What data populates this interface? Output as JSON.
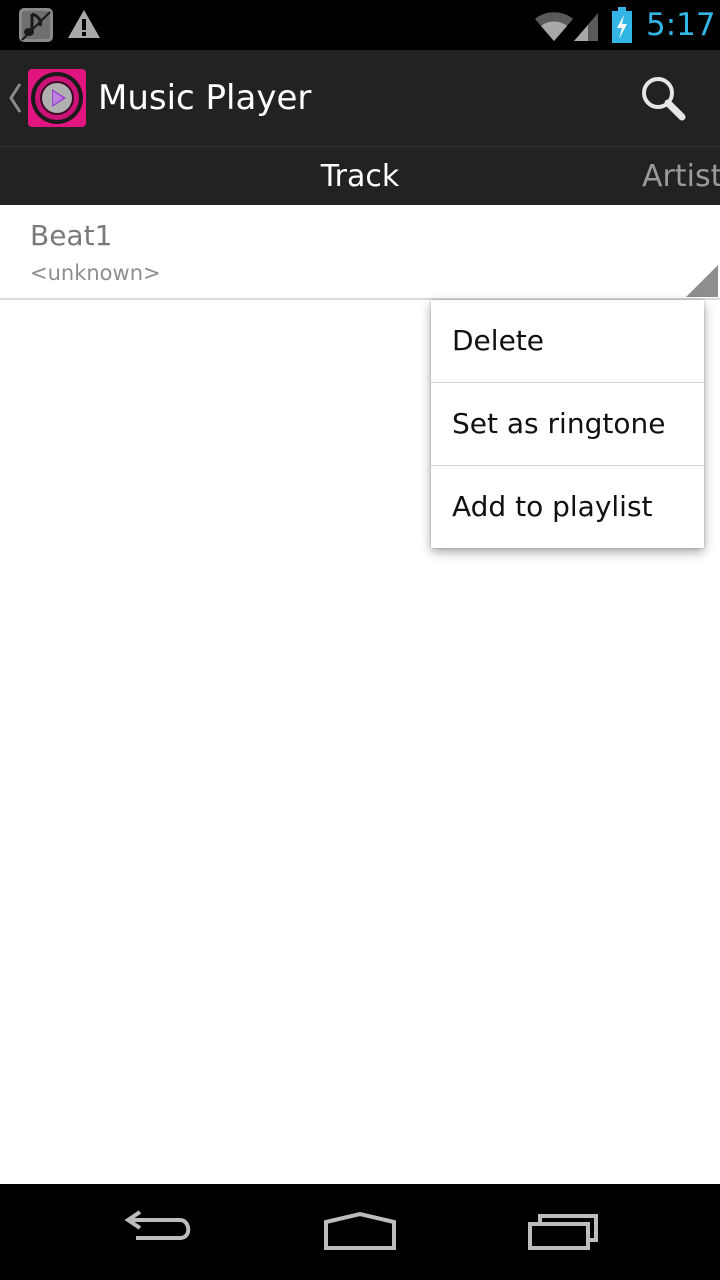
{
  "status_bar": {
    "time": "5:17",
    "notifications": [
      "music-note-icon",
      "warning-icon"
    ],
    "indicators": [
      "wifi-icon",
      "signal-icon",
      "battery-charging-icon"
    ],
    "clock_color": "#33b5e5"
  },
  "action_bar": {
    "title": "Music Player",
    "app_icon": "music-player-app-icon",
    "search_icon": "search-icon",
    "background": "#222222"
  },
  "tabs": [
    {
      "label": "Track",
      "selected": true
    },
    {
      "label": "Artist",
      "selected": false
    }
  ],
  "list": {
    "items": [
      {
        "title": "Beat1",
        "subtitle": "<unknown>"
      }
    ]
  },
  "context_menu": {
    "items": [
      {
        "label": "Delete"
      },
      {
        "label": "Set as ringtone"
      },
      {
        "label": "Add to playlist"
      }
    ]
  },
  "nav_bar": {
    "buttons": [
      "back-icon",
      "home-icon",
      "recents-icon"
    ]
  }
}
